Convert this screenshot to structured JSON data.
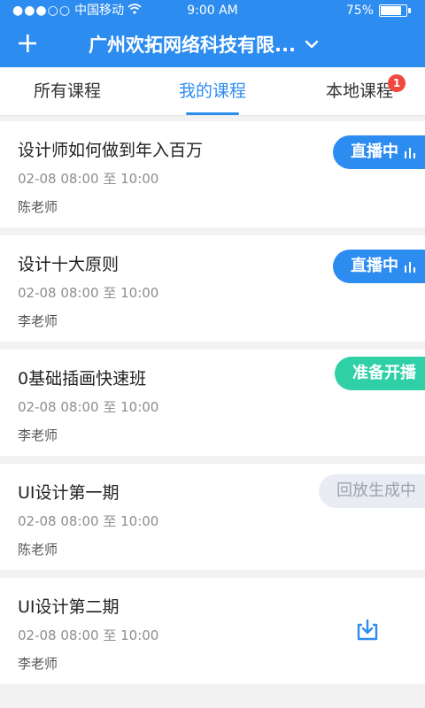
{
  "status_bar": {
    "signal": "●●●○○",
    "carrier": "中国移动",
    "time": "9:00 AM",
    "battery": "75%"
  },
  "header": {
    "title": "广州欢拓网络科技有限...",
    "colors": {
      "primary": "#2d8cf0"
    }
  },
  "tabs": [
    {
      "label": "所有课程"
    },
    {
      "label": "我的课程"
    },
    {
      "label": "本地课程",
      "badge": "1"
    }
  ],
  "courses": [
    {
      "title": "设计师如何做到年入百万",
      "time": "02-08 08:00 至 10:00",
      "teacher": "陈老师",
      "status": "直播中"
    },
    {
      "title": "设计十大原则",
      "time": "02-08 08:00 至 10:00",
      "teacher": "李老师",
      "status": "直播中"
    },
    {
      "title": "0基础插画快速班",
      "time": "02-08 08:00 至 10:00",
      "teacher": "李老师",
      "status": "准备开播"
    },
    {
      "title": "UI设计第一期",
      "time": "02-08 08:00 至 10:00",
      "teacher": "陈老师",
      "status": "回放生成中"
    },
    {
      "title": "UI设计第二期",
      "time": "02-08 08:00 至 10:00",
      "teacher": "李老师",
      "status": "",
      "icon": "download-icon"
    }
  ]
}
